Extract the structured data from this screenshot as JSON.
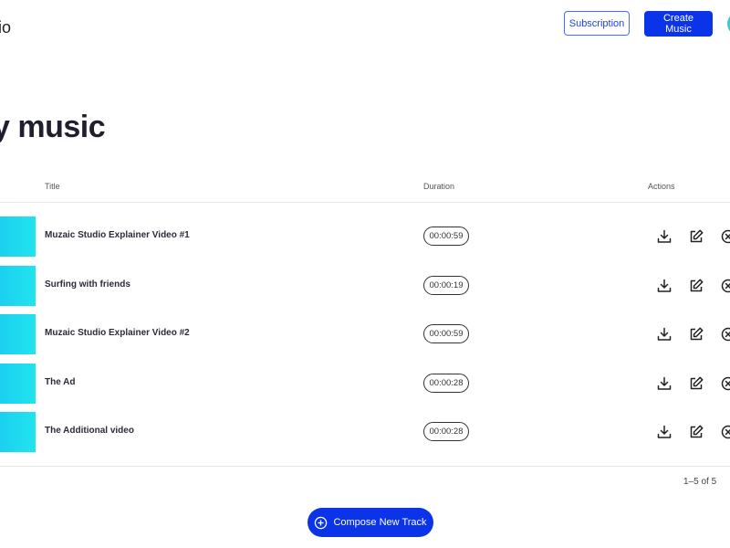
{
  "header": {
    "logo_text": "io",
    "subscription_label": "Subscription",
    "create_label": "Create Music"
  },
  "page": {
    "title": "y music"
  },
  "table": {
    "columns": [
      "Title",
      "Duration",
      "Actions"
    ],
    "rows": [
      {
        "title": "Muzaic Studio Explainer Video #1",
        "duration": "00:00:59"
      },
      {
        "title": "Surfing with friends",
        "duration": "00:00:19"
      },
      {
        "title": "Muzaic Studio Explainer Video #2",
        "duration": "00:00:59"
      },
      {
        "title": "The Ad",
        "duration": "00:00:28"
      },
      {
        "title": "The Additional video",
        "duration": "00:00:28"
      }
    ],
    "row_actions": [
      "download-icon",
      "edit-icon",
      "delete-icon"
    ],
    "pagination": "1–5 of 5"
  },
  "footer": {
    "compose_label": "Compose New Track"
  },
  "colors": {
    "accent": "#0b33e8",
    "thumb_gradient": [
      "#1bd0f0",
      "#21e4ee"
    ]
  }
}
